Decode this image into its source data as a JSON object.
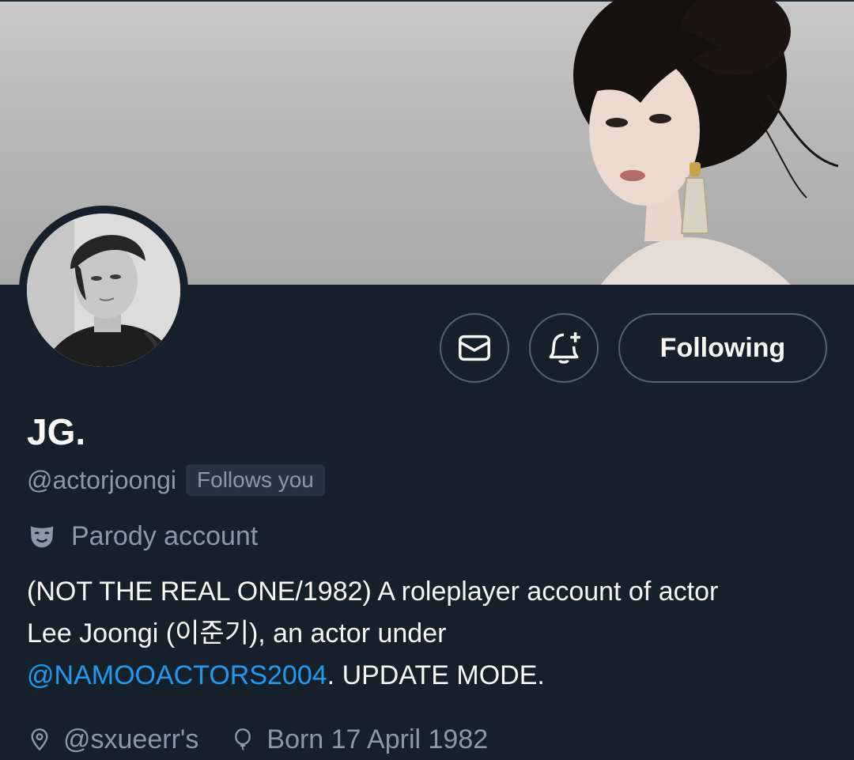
{
  "profile": {
    "display_name": "JG.",
    "handle": "@actorjoongi",
    "follows_you": "Follows you",
    "parody_label": "Parody account",
    "bio": {
      "part1": "(NOT THE REAL ONE/1982) A roleplayer account of actor Lee Joongi (이준기), an actor under ",
      "mention": "@NAMOOACTORS2004",
      "part2": ". UPDATE MODE."
    },
    "location": "@sxueerr's",
    "birthday": "Born 17 April 1982"
  },
  "actions": {
    "following_label": "Following"
  },
  "icons": {
    "message": "envelope-icon",
    "notify": "bell-plus-icon",
    "parody": "theater-mask-icon",
    "location": "location-pin-icon",
    "birthday": "balloon-icon"
  },
  "colors": {
    "background": "#15202b",
    "text_primary": "#f7f9f9",
    "text_secondary": "#8b98a5",
    "link": "#1d9bf0",
    "border": "#536471"
  }
}
